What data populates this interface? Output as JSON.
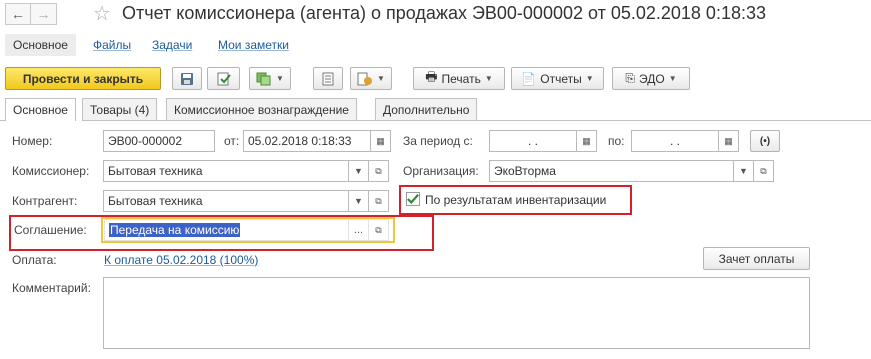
{
  "window": {
    "title": "Отчет комиссионера (агента) о продажах ЭВ00-000002 от 05.02.2018 0:18:33",
    "back_icon": "arrow-left-icon",
    "forward_icon": "arrow-right-icon",
    "favorite_icon": "star-icon"
  },
  "sections": [
    "Основное",
    "Файлы",
    "Задачи",
    "Мои заметки"
  ],
  "toolbar": {
    "post_and_close": "Провести и закрыть",
    "print": "Печать",
    "reports": "Отчеты",
    "edo": "ЭДО"
  },
  "tabs": [
    "Основное",
    "Товары (4)",
    "Комиссионное вознаграждение",
    "Дополнительно"
  ],
  "form": {
    "number_label": "Номер:",
    "number_value": "ЭВ00-000002",
    "date_label": "от:",
    "date_value": "05.02.2018  0:18:33",
    "period_label": "За период с:",
    "period_from": ".  .",
    "period_to_label": "по:",
    "period_to": ".  .",
    "commissioner_label": "Комиссионер:",
    "commissioner_value": "Бытовая техника",
    "organization_label": "Организация:",
    "organization_value": "ЭкоВторма",
    "counterparty_label": "Контрагент:",
    "counterparty_value": "Бытовая техника",
    "inventory_label": "По результатам инвентаризации",
    "inventory_checked": true,
    "agreement_label": "Соглашение:",
    "agreement_value": "Передача на комиссию",
    "payment_label": "Оплата:",
    "payment_link": "К оплате 05.02.2018 (100%)",
    "offset_button": "Зачет оплаты",
    "comment_label": "Комментарий:",
    "comment_value": ""
  },
  "colors": {
    "primary_button": "#f2c81d",
    "highlight_box": "#d4202a",
    "link": "#1c5b9e",
    "selection": "#3b62c4",
    "check": "#2e8b3a"
  }
}
